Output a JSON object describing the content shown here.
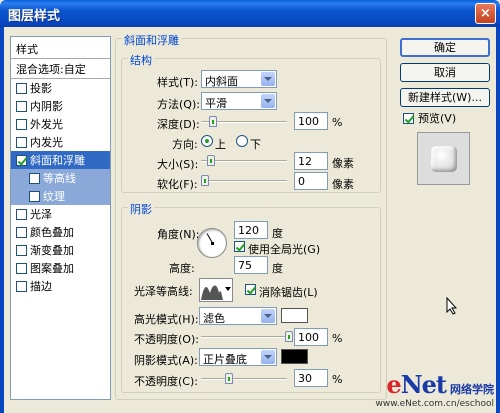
{
  "window": {
    "title": "图层样式",
    "close": "×"
  },
  "style_list": {
    "header": "样式",
    "blend": "混合选项:自定",
    "items": [
      {
        "label": "投影",
        "checked": false
      },
      {
        "label": "内阴影",
        "checked": false
      },
      {
        "label": "外发光",
        "checked": false
      },
      {
        "label": "内发光",
        "checked": false
      },
      {
        "label": "斜面和浮雕",
        "checked": true,
        "selected": true
      },
      {
        "label": "等高线",
        "checked": false,
        "sub": true
      },
      {
        "label": "纹理",
        "checked": false,
        "sub": true
      },
      {
        "label": "光泽",
        "checked": false
      },
      {
        "label": "颜色叠加",
        "checked": false
      },
      {
        "label": "渐变叠加",
        "checked": false
      },
      {
        "label": "图案叠加",
        "checked": false
      },
      {
        "label": "描边",
        "checked": false
      }
    ]
  },
  "buttons": {
    "ok": "确定",
    "cancel": "取消",
    "new_style": "新建样式(W)...",
    "preview": "预览(V)"
  },
  "bevel": {
    "group_title": "斜面和浮雕",
    "structure_title": "结构",
    "style_label": "样式(T):",
    "style_value": "内斜面",
    "method_label": "方法(Q):",
    "method_value": "平滑",
    "depth_label": "深度(D):",
    "depth_value": "100",
    "depth_unit": "%",
    "direction_label": "方向:",
    "direction_up": "上",
    "direction_down": "下",
    "size_label": "大小(S):",
    "size_value": "12",
    "size_unit": "像素",
    "soften_label": "软化(F):",
    "soften_value": "0",
    "soften_unit": "像素"
  },
  "shading": {
    "group_title": "阴影",
    "angle_label": "角度(N):",
    "angle_value": "120",
    "angle_unit": "度",
    "global_light": "使用全局光(G)",
    "altitude_label": "高度:",
    "altitude_value": "75",
    "altitude_unit": "度",
    "gloss_label": "光泽等高线:",
    "anti_alias": "消除锯齿(L)",
    "highlight_mode_label": "高光模式(H):",
    "highlight_mode_value": "滤色",
    "highlight_opacity_label": "不透明度(O):",
    "highlight_opacity_value": "100",
    "highlight_opacity_unit": "%",
    "shadow_mode_label": "阴影模式(A):",
    "shadow_mode_value": "正片叠底",
    "shadow_opacity_label": "不透明度(C):",
    "shadow_opacity_value": "30",
    "shadow_opacity_unit": "%"
  },
  "colors": {
    "highlight": "#ffffff",
    "shadow": "#000000",
    "accent": "#0046d5"
  },
  "watermark": {
    "brand_e": "e",
    "brand_rest": "Net",
    "cn": "网络学院",
    "url": "www.eNet.com.cn/eschool"
  }
}
